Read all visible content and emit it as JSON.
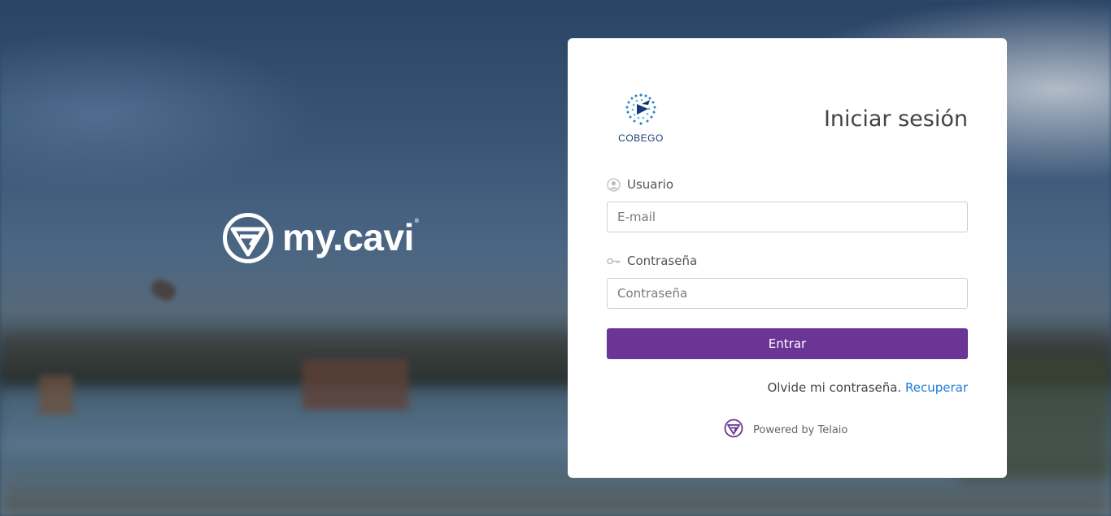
{
  "brand": {
    "title": "my.cavi",
    "reg_mark": "®"
  },
  "card": {
    "logo_text": "COBEGO",
    "title": "Iniciar sesión",
    "username_label": "Usuario",
    "email_placeholder": "E-mail",
    "password_label": "Contraseña",
    "password_placeholder": "Contraseña",
    "submit_label": "Entrar",
    "forgot_text": "Olvide mi contraseña.",
    "recover_link": "Recuperar",
    "powered_by": "Powered by Telaio"
  },
  "colors": {
    "primary": "#6a3594",
    "link": "#1e7bd6",
    "logo_blue": "#1e3a7a"
  },
  "icons": {
    "brand": "mycavi-logo-icon",
    "user": "user-circle-icon",
    "key": "key-icon",
    "telaio": "telaio-logo-icon"
  }
}
